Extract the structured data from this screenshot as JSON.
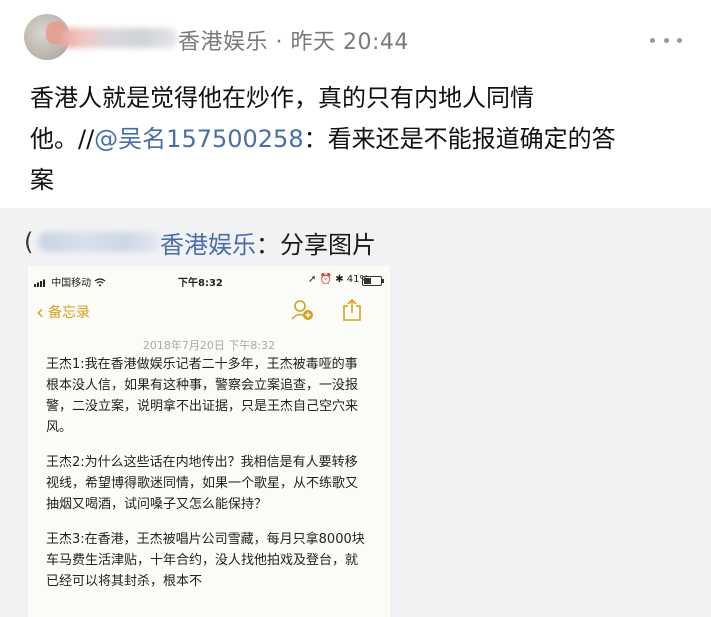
{
  "post": {
    "meta": "香港娱乐 · 昨天 20:44",
    "text_line1": "香港人就是觉得他在炒作，真的只有内地人同情",
    "text_line2_before": "他。//",
    "text_line2_mention": "@吴名157500258",
    "text_line2_after": "：看来还是不能报道确定的答",
    "text_line3": "案"
  },
  "repost": {
    "bracket": "(",
    "author": "香港娱乐",
    "suffix": "：分享图片"
  },
  "phone": {
    "carrier": "中国移动",
    "time": "下午8:32",
    "status_right": "41%",
    "back_label": "备忘录",
    "note_date": "2018年7月20日 下午8:32",
    "paragraphs": [
      "王杰1:我在香港做娱乐记者二十多年，王杰被毒哑的事根本没人信，如果有这种事，警察会立案追查，一没报警，二没立案，说明拿不出证据，只是王杰自己空穴来风。",
      "王杰2:为什么这些话在内地传出？我相信是有人要转移视线，希望博得歌迷同情，如果一个歌星，从不练歌又抽烟又喝酒，试问嗓子又怎么能保持？",
      "王杰3:在香港，王杰被唱片公司雪藏，每月只拿8000块车马费生活津贴，十年合约，没人找他拍戏及登台，就已经可以将其封杀，根本不"
    ]
  },
  "colors": {
    "mention": "#4a6ea9",
    "notes_accent": "#d9a01a",
    "repost_bg": "#f1f2f4"
  },
  "icons": [
    "more-dots-icon",
    "chevron-left-icon",
    "add-person-icon",
    "share-icon",
    "wifi-icon",
    "signal-icon"
  ]
}
